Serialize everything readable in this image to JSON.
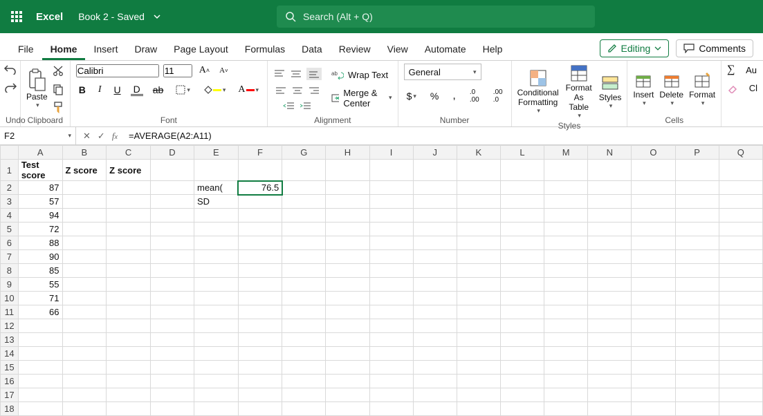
{
  "title": {
    "app": "Excel",
    "doc": "Book 2  -  Saved"
  },
  "search": {
    "placeholder": "Search (Alt + Q)"
  },
  "tabs": {
    "file": "File",
    "home": "Home",
    "insert": "Insert",
    "draw": "Draw",
    "pagelayout": "Page Layout",
    "formulas": "Formulas",
    "data": "Data",
    "review": "Review",
    "view": "View",
    "automate": "Automate",
    "help": "Help"
  },
  "editing": "Editing",
  "comments": "Comments",
  "ribbon": {
    "undo": "Undo",
    "clipboard": {
      "paste": "Paste",
      "label": "Clipboard"
    },
    "font": {
      "name": "Calibri",
      "size": "11",
      "label": "Font"
    },
    "alignment": {
      "wrap": "Wrap Text",
      "merge": "Merge & Center",
      "label": "Alignment"
    },
    "number": {
      "format": "General",
      "label": "Number"
    },
    "styles": {
      "cond": "Conditional Formatting",
      "fat": "Format As Table",
      "styles": "Styles",
      "label": "Styles"
    },
    "cells": {
      "insert": "Insert",
      "delete": "Delete",
      "format": "Format",
      "label": "Cells"
    },
    "edit": {
      "au": "Au",
      "cl": "Cl"
    }
  },
  "fx": {
    "cell": "F2",
    "formula": "=AVERAGE(A2:A11)"
  },
  "columns": [
    "A",
    "B",
    "C",
    "D",
    "E",
    "F",
    "G",
    "H",
    "I",
    "J",
    "K",
    "L",
    "M",
    "N",
    "O",
    "P",
    "Q"
  ],
  "headers": {
    "a1": "Test score",
    "b1": "Z score",
    "c1": "Z score"
  },
  "labels": {
    "e2": "mean(",
    "e3": "SD"
  },
  "values": {
    "f2": "76.5"
  },
  "scores": [
    "87",
    "57",
    "94",
    "72",
    "88",
    "90",
    "85",
    "55",
    "71",
    "66"
  ],
  "chart_data": {
    "type": "table",
    "title": "Test scores with mean",
    "columns": [
      "Test score"
    ],
    "rows": [
      [
        87
      ],
      [
        57
      ],
      [
        94
      ],
      [
        72
      ],
      [
        88
      ],
      [
        90
      ],
      [
        85
      ],
      [
        55
      ],
      [
        71
      ],
      [
        66
      ]
    ],
    "summary": {
      "mean": 76.5
    }
  }
}
